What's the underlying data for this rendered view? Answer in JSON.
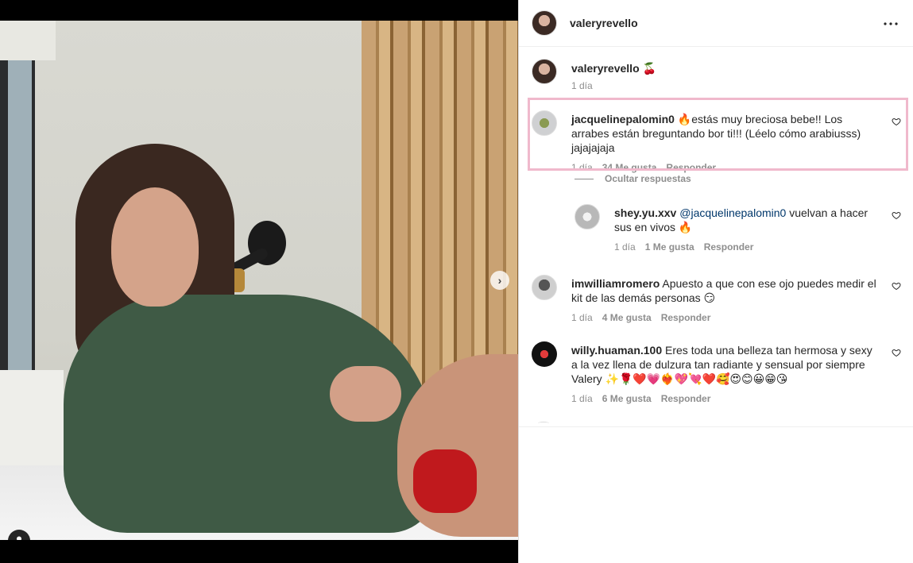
{
  "post": {
    "username": "valeryrevello",
    "caption": {
      "username": "valeryrevello",
      "emoji": "🍒",
      "time": "1 día"
    },
    "carousel": {
      "count": 10,
      "active_index": 0
    }
  },
  "comments": [
    {
      "username": "jacquelinepalomin0",
      "text": "🔥estás muy breciosa bebe!! Los arrabes están breguntando bor ti!!! (Léelo cómo arabiusss) jajajajaja",
      "time": "1 día",
      "likes": "34 Me gusta",
      "reply_label": "Responder",
      "highlighted": true,
      "hide_replies_label": "Ocultar respuestas",
      "replies": [
        {
          "username": "shey.yu.xxv",
          "mention": "@jacquelinepalomin0",
          "text": " vuelvan a hacer sus en vivos 🔥",
          "time": "1 día",
          "likes": "1 Me gusta",
          "reply_label": "Responder"
        }
      ]
    },
    {
      "username": "imwilliamromero",
      "text": "Apuesto a que con ese ojo puedes medir el kit de las demás personas 😏",
      "time": "1 día",
      "likes": "4 Me gusta",
      "reply_label": "Responder"
    },
    {
      "username": "willy.huaman.100",
      "text": "Eres toda una belleza tan hermosa y sexy a la vez llena de dulzura tan radiante y sensual por siempre Valery ✨🌹❤️💗❤️‍🔥💖💘❤️🥰😍😊😀😁😘",
      "time": "1 día",
      "likes": "6 Me gusta",
      "reply_label": "Responder"
    }
  ],
  "colors": {
    "highlight_border": "#f0b9cc",
    "link_blue": "#00376b",
    "muted": "#8e8e8e"
  },
  "icons": {
    "more": "more-horizontal-icon",
    "heart": "heart-outline-icon",
    "next": "chevron-right-icon",
    "user_tag": "user-tag-icon"
  }
}
